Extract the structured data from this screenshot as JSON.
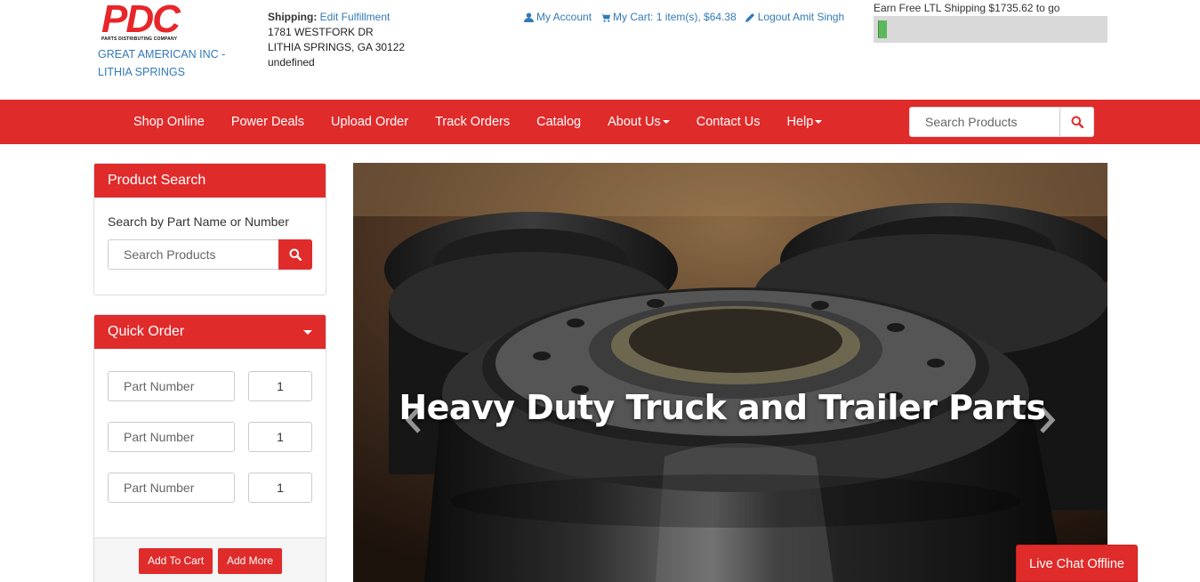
{
  "brand": {
    "logo_text": "PDC",
    "logo_subtext": "PARTS DISTRIBUTING COMPANY",
    "accent": "#e02b2b"
  },
  "company": {
    "line1": "GREAT AMERICAN INC -",
    "line2": "LITHIA SPRINGS"
  },
  "shipping": {
    "label": "Shipping:",
    "edit_link": "Edit Fulfillment",
    "address1": "1781 WESTFORK DR",
    "address2": "LITHIA SPRINGS, GA 30122",
    "address3": "undefined"
  },
  "account": {
    "my_account": "My Account",
    "my_cart": "My Cart: 1 item(s), $64.38",
    "logout": "Logout Amit Singh"
  },
  "ltl": {
    "text": "Earn Free LTL Shipping $1735.62 to go",
    "progress_fraction": 0.04
  },
  "nav": {
    "items": [
      {
        "label": "Shop Online",
        "dropdown": false
      },
      {
        "label": "Power Deals",
        "dropdown": false
      },
      {
        "label": "Upload Order",
        "dropdown": false
      },
      {
        "label": "Track Orders",
        "dropdown": false
      },
      {
        "label": "Catalog",
        "dropdown": false
      },
      {
        "label": "About Us",
        "dropdown": true
      },
      {
        "label": "Contact Us",
        "dropdown": false
      },
      {
        "label": "Help",
        "dropdown": true
      }
    ],
    "search_placeholder": "Search Products"
  },
  "product_search": {
    "title": "Product Search",
    "label": "Search by Part Name or Number",
    "placeholder": "Search Products"
  },
  "quick_order": {
    "title": "Quick Order",
    "rows": [
      {
        "part_placeholder": "Part Number",
        "qty": "1"
      },
      {
        "part_placeholder": "Part Number",
        "qty": "1"
      },
      {
        "part_placeholder": "Part Number",
        "qty": "1"
      }
    ],
    "add_to_cart": "Add To Cart",
    "add_more": "Add More"
  },
  "hero": {
    "title": "Heavy Duty Truck and Trailer Parts"
  },
  "chat": {
    "label": "Live Chat Offline"
  }
}
